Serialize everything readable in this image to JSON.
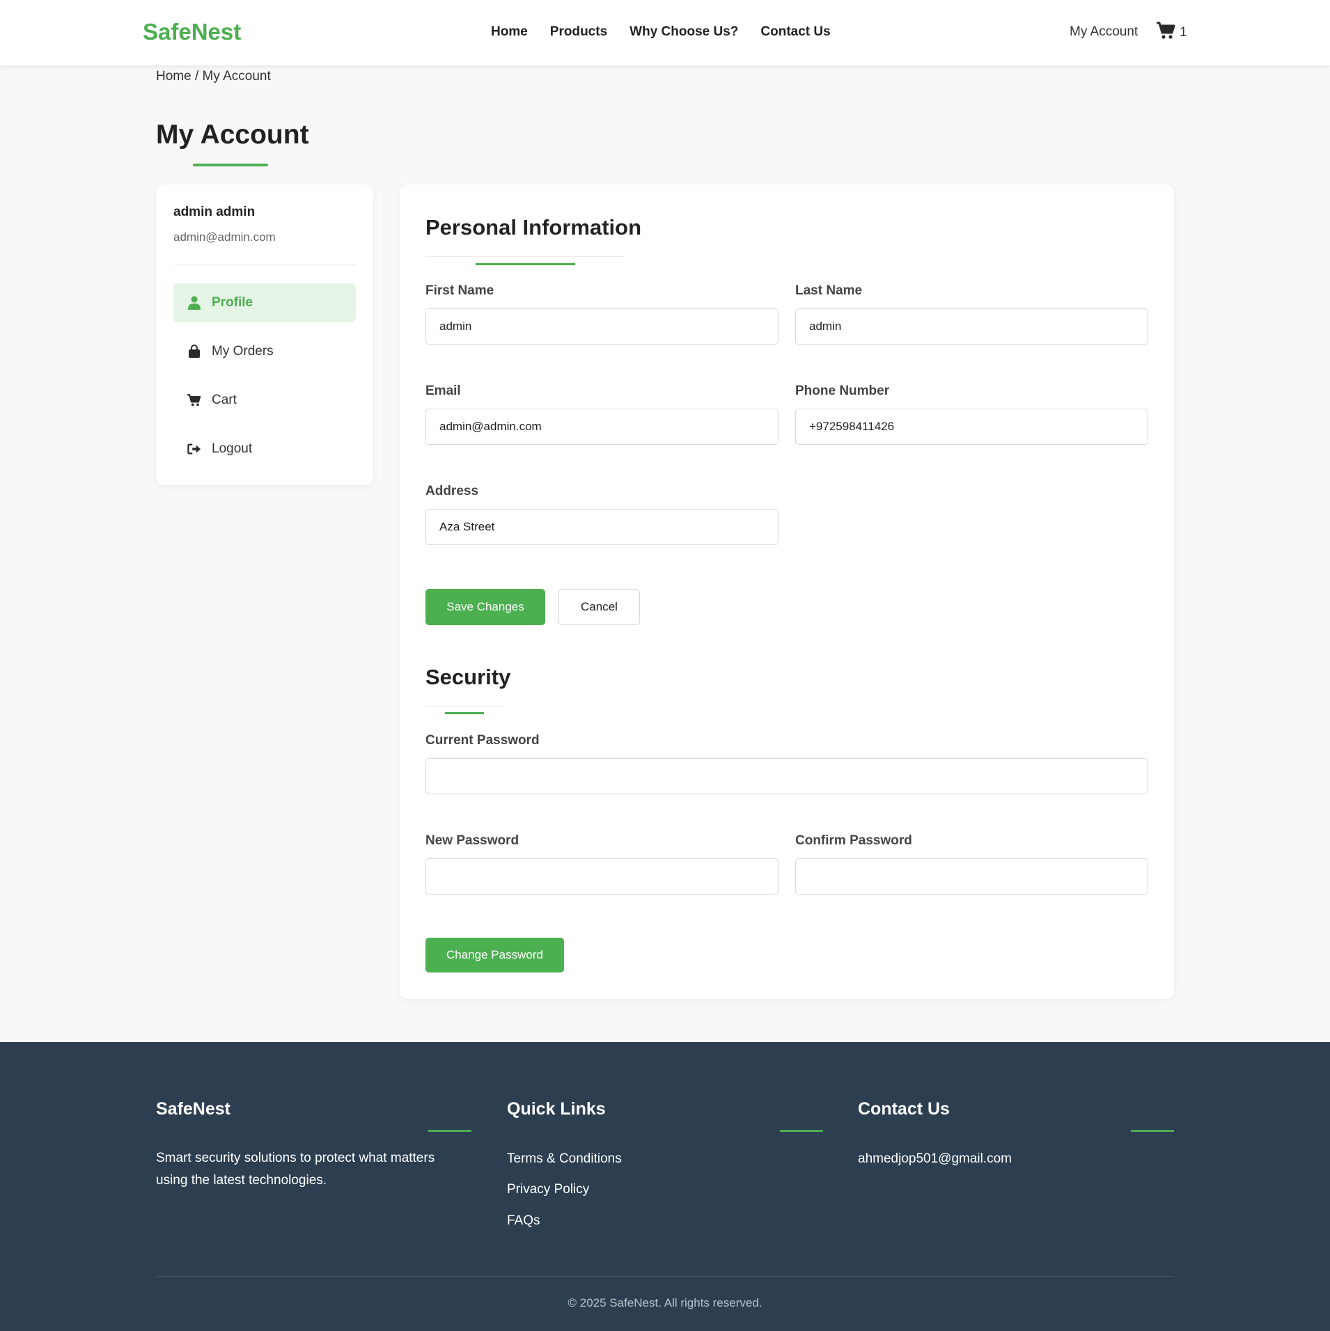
{
  "header": {
    "logo": "SafeNest",
    "nav": [
      "Home",
      "Products",
      "Why Choose Us?",
      "Contact Us"
    ],
    "account_label": "My Account",
    "cart_count": "1",
    "brand_color": "#4caf50"
  },
  "breadcrumb": {
    "home": "Home",
    "separator": "/",
    "current": "My Account"
  },
  "page_title": "My Account",
  "sidebar": {
    "user_name": "admin admin",
    "user_email": "admin@admin.com",
    "items": [
      {
        "label": "Profile",
        "icon": "user-icon",
        "active": true
      },
      {
        "label": "My Orders",
        "icon": "shopping-bag-icon",
        "active": false
      },
      {
        "label": "Cart",
        "icon": "cart-icon",
        "active": false
      },
      {
        "label": "Logout",
        "icon": "logout-icon",
        "active": false
      }
    ]
  },
  "personal": {
    "title": "Personal Information",
    "first_name_label": "First Name",
    "first_name_value": "admin",
    "last_name_label": "Last Name",
    "last_name_value": "admin",
    "email_label": "Email",
    "email_value": "admin@admin.com",
    "phone_label": "Phone Number",
    "phone_value": "+972598411426",
    "address_label": "Address",
    "address_value": "Aza Street",
    "save_label": "Save Changes",
    "cancel_label": "Cancel"
  },
  "security": {
    "title": "Security",
    "current_label": "Current Password",
    "current_value": "",
    "new_label": "New Password",
    "new_value": "",
    "confirm_label": "Confirm Password",
    "confirm_value": "",
    "change_label": "Change Password"
  },
  "footer": {
    "brand_title": "SafeNest",
    "brand_text_line1": "Smart security solutions to protect what matters",
    "brand_text_line2": "using the latest technologies.",
    "links_title": "Quick Links",
    "links": [
      "Terms & Conditions",
      "Privacy Policy",
      "FAQs"
    ],
    "contact_title": "Contact Us",
    "contact_email": "ahmedjop501@gmail.com",
    "copyright": "© 2025 SafeNest. All rights reserved."
  }
}
